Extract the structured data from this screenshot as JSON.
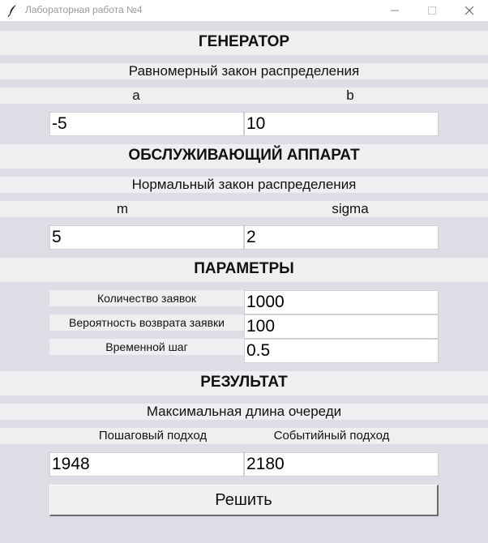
{
  "window": {
    "title": "Лабораторная работа №4"
  },
  "generator": {
    "heading": "ГЕНЕРАТОР",
    "distribution": "Равномерный закон распределения",
    "param_a_label": "a",
    "param_b_label": "b",
    "param_a_value": "-5",
    "param_b_value": "10"
  },
  "server": {
    "heading": "ОБСЛУЖИВАЮЩИЙ АППАРАТ",
    "distribution": "Нормальный закон распределения",
    "param_m_label": "m",
    "param_sigma_label": "sigma",
    "param_m_value": "5",
    "param_sigma_value": "2"
  },
  "parameters": {
    "heading": "ПАРАМЕТРЫ",
    "request_count_label": "Количество заявок",
    "request_count_value": "1000",
    "return_probability_label": "Вероятность возврата заявки",
    "return_probability_value": "100",
    "time_step_label": "Временной шаг",
    "time_step_value": "0.5"
  },
  "result": {
    "heading": "РЕЗУЛЬТАТ",
    "subtitle": "Максимальная длина очереди",
    "step_label": "Пошаговый подход",
    "event_label": "Событийный подход",
    "step_value": "1948",
    "event_value": "2180"
  },
  "actions": {
    "solve_label": "Решить"
  }
}
